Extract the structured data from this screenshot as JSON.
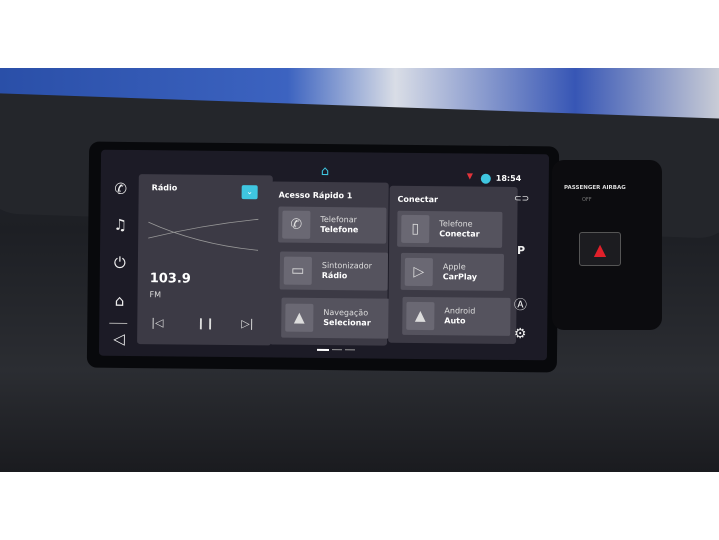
{
  "status": {
    "time": "18:54",
    "home_icon": "home-icon",
    "wifi_icon": "wifi-icon",
    "user_icon": "user-icon",
    "accent": "#3fc6e0",
    "wifi_color": "#e2333a"
  },
  "left_nav": [
    {
      "icon": "phone-icon",
      "glyph": "✆"
    },
    {
      "icon": "music-icon",
      "glyph": "♫"
    },
    {
      "icon": "power-icon",
      "glyph": "⏻"
    },
    {
      "icon": "bag-icon",
      "glyph": "⌂"
    },
    {
      "icon": "volume-icon",
      "glyph": "◁"
    }
  ],
  "right_nav": [
    {
      "icon": "car-icon",
      "glyph": "⊂⊃"
    },
    {
      "icon": "parking-icon",
      "glyph": "P"
    },
    {
      "icon": "assist-off-icon",
      "glyph": "Ⓐ"
    },
    {
      "icon": "settings-icon",
      "glyph": "⚙"
    }
  ],
  "radio": {
    "title": "Rádio",
    "frequency": "103.9",
    "band": "FM",
    "prev": "|◁",
    "pause": "❙❙",
    "next": "▷|"
  },
  "quick_access": {
    "title": "Acesso Rápido 1",
    "items": [
      {
        "line1": "Telefonar",
        "line2": "Telefone",
        "icon": "phone-icon",
        "glyph": "✆"
      },
      {
        "line1": "Sintonizador",
        "line2": "Rádio",
        "icon": "radio-icon",
        "glyph": "▭"
      },
      {
        "line1": "Navegação",
        "line2": "Selecionar",
        "icon": "navigation-icon",
        "glyph": "▲"
      }
    ]
  },
  "connect": {
    "title": "Conectar",
    "items": [
      {
        "line1": "Telefone",
        "line2": "Conectar",
        "icon": "phone-add-icon",
        "glyph": "▯"
      },
      {
        "line1": "Apple",
        "line2": "CarPlay",
        "icon": "carplay-icon",
        "glyph": "▷"
      },
      {
        "line1": "Android",
        "line2": "Auto",
        "icon": "android-auto-icon",
        "glyph": "▲"
      }
    ]
  },
  "panel": {
    "label": "PASSENGER AIRBAG",
    "off": "OFF",
    "hazard_color": "#e0202a"
  }
}
